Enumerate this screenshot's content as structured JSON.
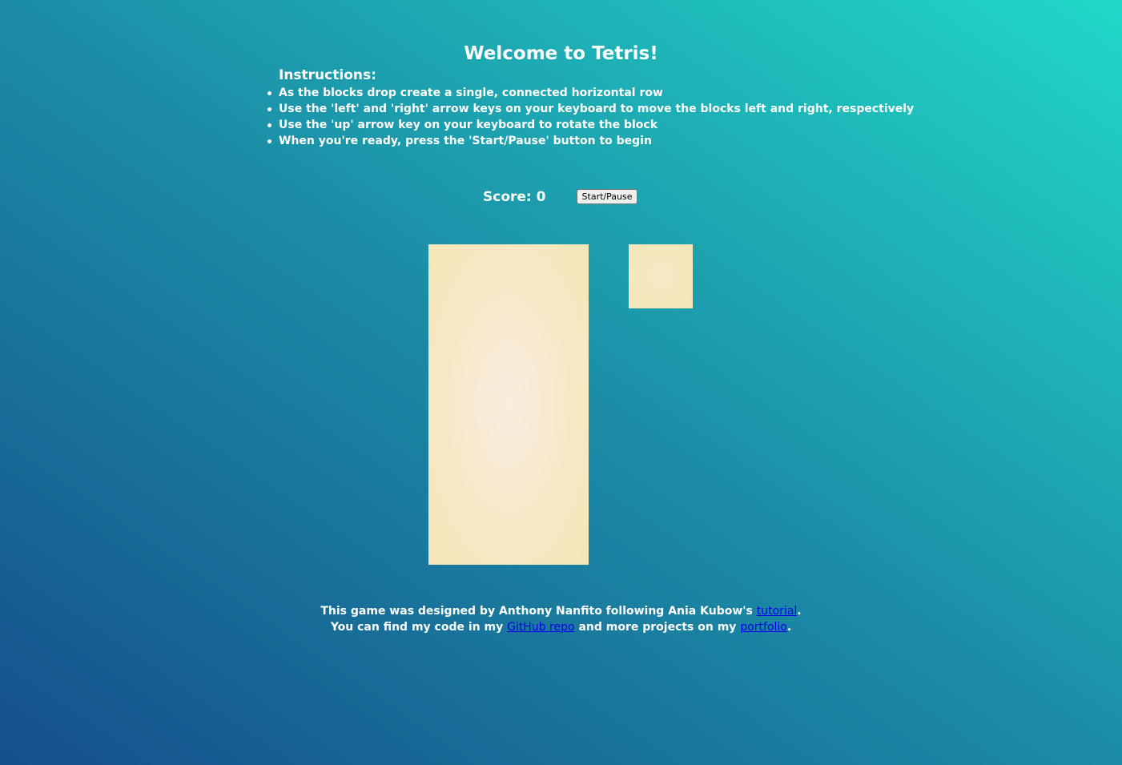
{
  "title": "Welcome to Tetris!",
  "instructions": {
    "heading": "Instructions:",
    "items": [
      "As the blocks drop create a single, connected horizontal row",
      "Use the 'left' and 'right' arrow keys on your keyboard to move the blocks left and right, respectively",
      "Use the 'up' arrow key on your keyboard to rotate the block",
      "When you're ready, press the 'Start/Pause' button to begin"
    ]
  },
  "score": {
    "label": "Score:",
    "value": "0"
  },
  "controls": {
    "start_pause_label": "Start/Pause"
  },
  "footer": {
    "line1_text": "This game was designed by Anthony Nanfito following Ania Kubow's",
    "line1_link": "tutorial",
    "line1_end": ".",
    "line2_text": "You can find my code in my",
    "line2_link1": "GitHub repo",
    "line2_mid": "and more projects on my",
    "line2_link2": "portfolio",
    "line2_end": "."
  },
  "colors": {
    "background_start": "#154f8c",
    "background_end": "#21d8c8",
    "board": "#f5e6b8",
    "link": "#0000ee"
  }
}
